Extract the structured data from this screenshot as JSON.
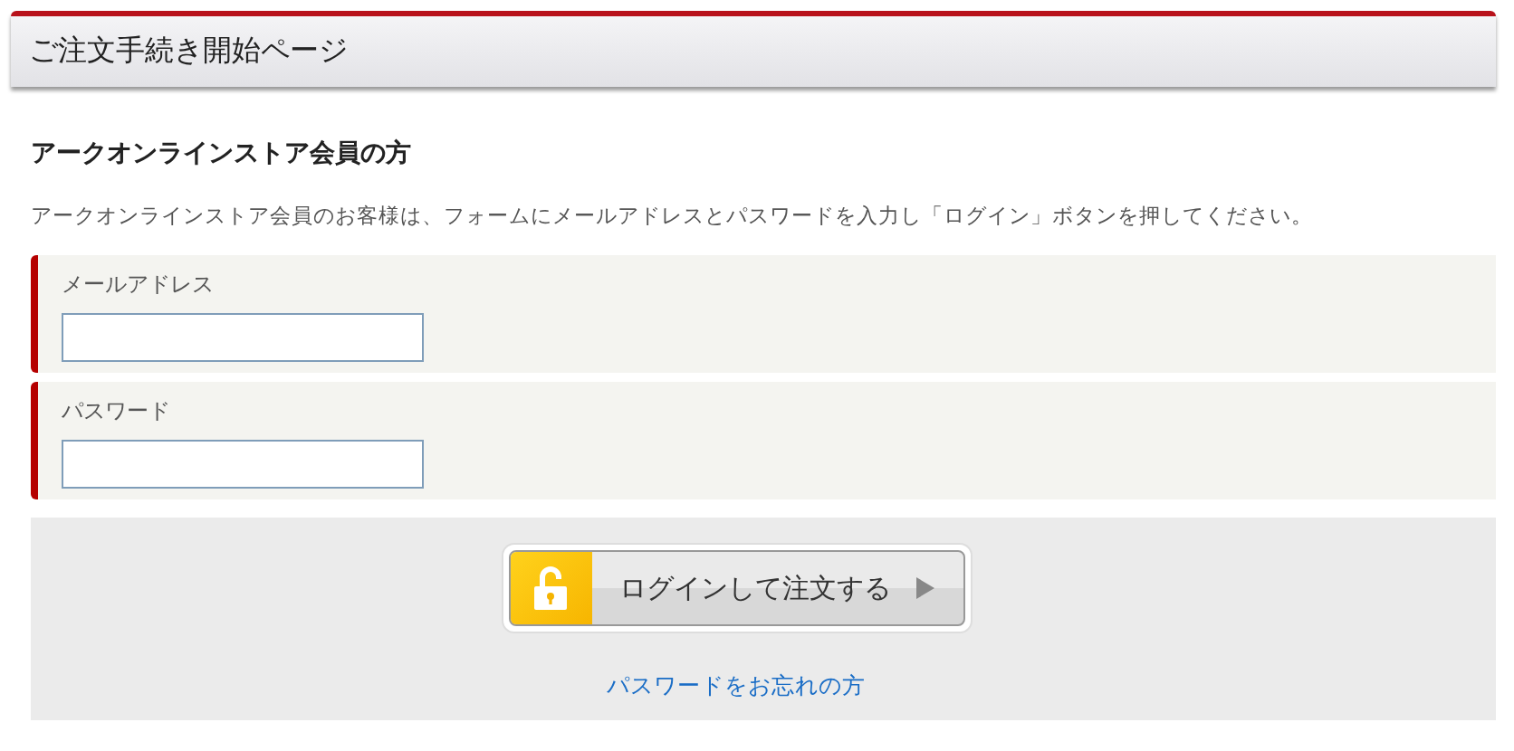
{
  "header": {
    "title": "ご注文手続き開始ページ"
  },
  "section": {
    "title": "アークオンラインストア会員の方",
    "description": "アークオンラインストア会員のお客様は、フォームにメールアドレスとパスワードを入力し「ログイン」ボタンを押してください。"
  },
  "fields": [
    {
      "label": "メールアドレス"
    },
    {
      "label": "パスワード"
    }
  ],
  "login_button": {
    "label": "ログインして注文する"
  },
  "forgot_link": {
    "label": "パスワードをお忘れの方"
  }
}
